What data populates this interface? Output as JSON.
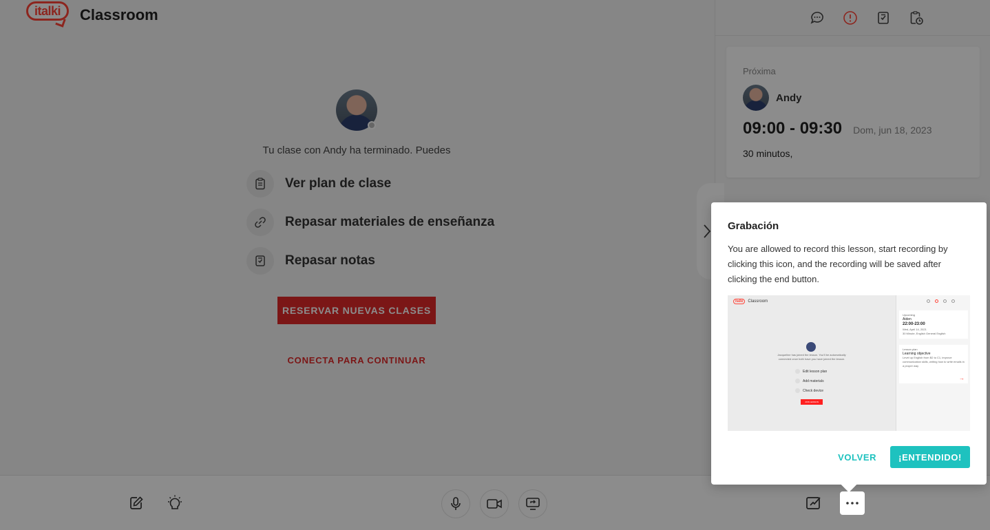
{
  "header": {
    "logo_text": "italki",
    "title": "Classroom"
  },
  "main": {
    "ended_message": "Tu clase con Andy ha terminado. Puedes",
    "options": [
      {
        "label": "Ver plan de clase",
        "icon": "clipboard-icon"
      },
      {
        "label": "Repasar materiales de enseñanza",
        "icon": "link-icon"
      },
      {
        "label": "Repasar notas",
        "icon": "notes-icon"
      }
    ],
    "reserve_button": "RESERVAR NUEVAS CLASES",
    "connect_link": "CONECTA PARA CONTINUAR"
  },
  "right_panel": {
    "tools": [
      "chat-icon",
      "info-icon",
      "notes-icon",
      "clipboard-clock-icon"
    ],
    "card": {
      "label": "Próxima",
      "teacher": "Andy",
      "time": "09:00 - 09:30",
      "date": "Dom, jun 18, 2023",
      "duration": "30 minutos,"
    }
  },
  "popup": {
    "title": "Grabación",
    "body": "You are allowed to record this lesson, start recording by clicking this icon, and the recording will be saved after clicking the end button.",
    "back_button": "VOLVER",
    "ok_button": "¡ENTENDIDO!",
    "preview": {
      "title": "Classroom",
      "logo": "italki",
      "message": "Jacqueline has joined the lesson. You'll be automatically connected once both have you have joined the lesson.",
      "rows": [
        "Edit lesson plan",
        "Add materials",
        "Check device"
      ],
      "button": "JOIN LESSON",
      "card1": {
        "label": "Upcoming",
        "name": "Aiden",
        "time": "22:00-23:00",
        "date": "Wed, April 14, 2021",
        "detail": "30 Minute, English General English"
      },
      "card2": {
        "label": "Lesson plan",
        "title": "Learning objective",
        "text": "Level up English from B2 to C1, improve communication skills, writing how to write emails in a proper way"
      }
    }
  },
  "colors": {
    "brand_red": "#ff4438",
    "action_red": "#e02828",
    "teal": "#1ec2bf"
  }
}
